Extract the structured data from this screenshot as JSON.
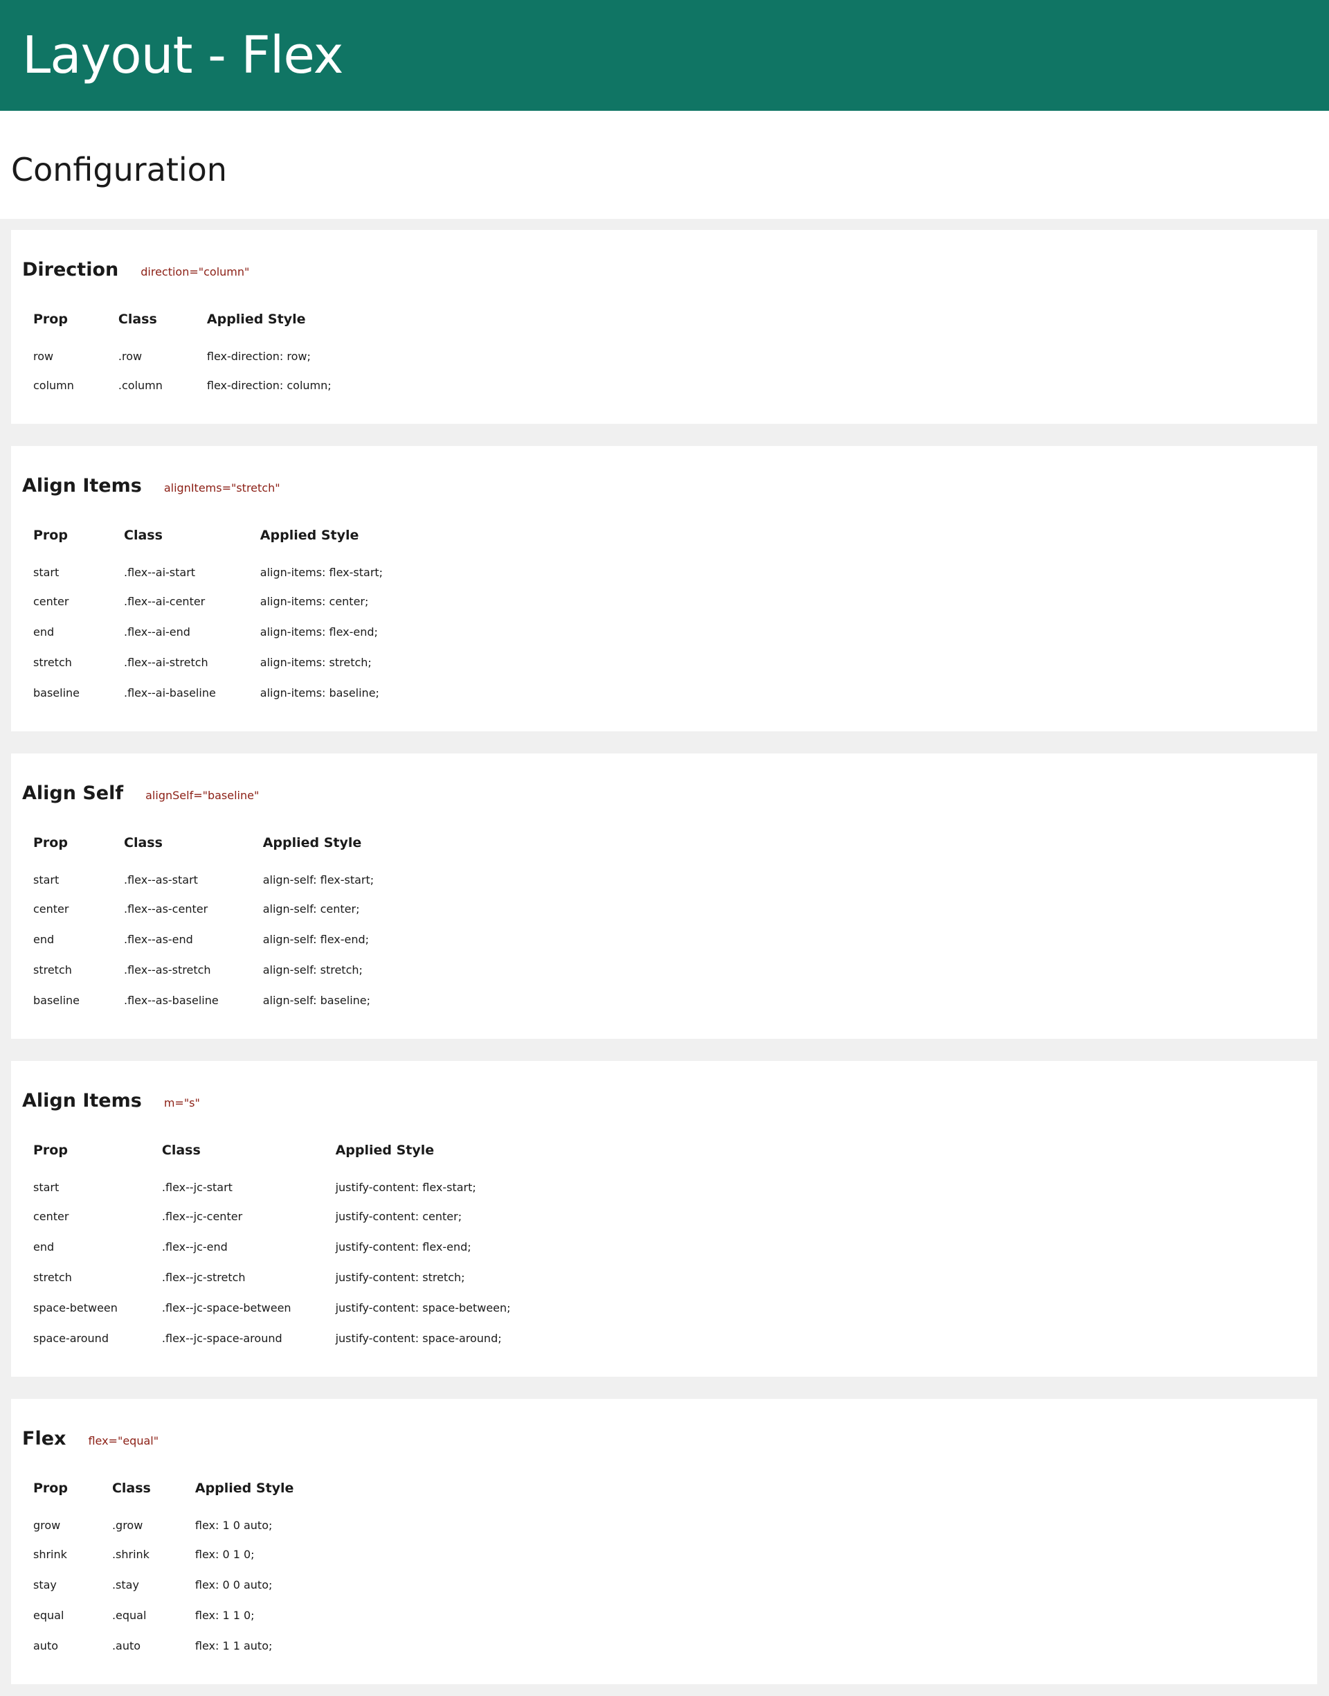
{
  "header": {
    "title": "Layout - Flex"
  },
  "page": {
    "section_title": "Configuration"
  },
  "table_headers": {
    "prop": "Prop",
    "class": "Class",
    "style": "Applied Style"
  },
  "colors": {
    "brand": "#107564",
    "code": "#8b1e14",
    "background": "#f0f0f0"
  },
  "sections": [
    {
      "title": "Direction",
      "code": "direction=\"column\"",
      "rows": [
        {
          "prop": "row",
          "class": ".row",
          "style": "flex-direction: row;"
        },
        {
          "prop": "column",
          "class": ".column",
          "style": "flex-direction: column;"
        }
      ]
    },
    {
      "title": "Align Items",
      "code": "alignItems=\"stretch\"",
      "rows": [
        {
          "prop": "start",
          "class": ".flex--ai-start",
          "style": "align-items: flex-start;"
        },
        {
          "prop": "center",
          "class": ".flex--ai-center",
          "style": "align-items: center;"
        },
        {
          "prop": "end",
          "class": ".flex--ai-end",
          "style": "align-items: flex-end;"
        },
        {
          "prop": "stretch",
          "class": ".flex--ai-stretch",
          "style": "align-items: stretch;"
        },
        {
          "prop": "baseline",
          "class": ".flex--ai-baseline",
          "style": "align-items: baseline;"
        }
      ]
    },
    {
      "title": "Align Self",
      "code": "alignSelf=\"baseline\"",
      "rows": [
        {
          "prop": "start",
          "class": ".flex--as-start",
          "style": "align-self: flex-start;"
        },
        {
          "prop": "center",
          "class": ".flex--as-center",
          "style": "align-self: center;"
        },
        {
          "prop": "end",
          "class": ".flex--as-end",
          "style": "align-self: flex-end;"
        },
        {
          "prop": "stretch",
          "class": ".flex--as-stretch",
          "style": "align-self: stretch;"
        },
        {
          "prop": "baseline",
          "class": ".flex--as-baseline",
          "style": "align-self: baseline;"
        }
      ]
    },
    {
      "title": "Align Items",
      "code": "m=\"s\"",
      "rows": [
        {
          "prop": "start",
          "class": ".flex--jc-start",
          "style": "justify-content: flex-start;"
        },
        {
          "prop": "center",
          "class": ".flex--jc-center",
          "style": "justify-content: center;"
        },
        {
          "prop": "end",
          "class": ".flex--jc-end",
          "style": "justify-content: flex-end;"
        },
        {
          "prop": "stretch",
          "class": ".flex--jc-stretch",
          "style": "justify-content: stretch;"
        },
        {
          "prop": "space-between",
          "class": ".flex--jc-space-between",
          "style": "justify-content: space-between;"
        },
        {
          "prop": "space-around",
          "class": ".flex--jc-space-around",
          "style": "justify-content: space-around;"
        }
      ]
    },
    {
      "title": "Flex",
      "code": "flex=\"equal\"",
      "rows": [
        {
          "prop": "grow",
          "class": ".grow",
          "style": "flex: 1 0 auto;"
        },
        {
          "prop": "shrink",
          "class": ".shrink",
          "style": "flex: 0 1 0;"
        },
        {
          "prop": "stay",
          "class": ".stay",
          "style": "flex: 0 0 auto;"
        },
        {
          "prop": "equal",
          "class": ".equal",
          "style": "flex: 1 1 0;"
        },
        {
          "prop": "auto",
          "class": ".auto",
          "style": "flex: 1 1 auto;"
        }
      ]
    }
  ]
}
